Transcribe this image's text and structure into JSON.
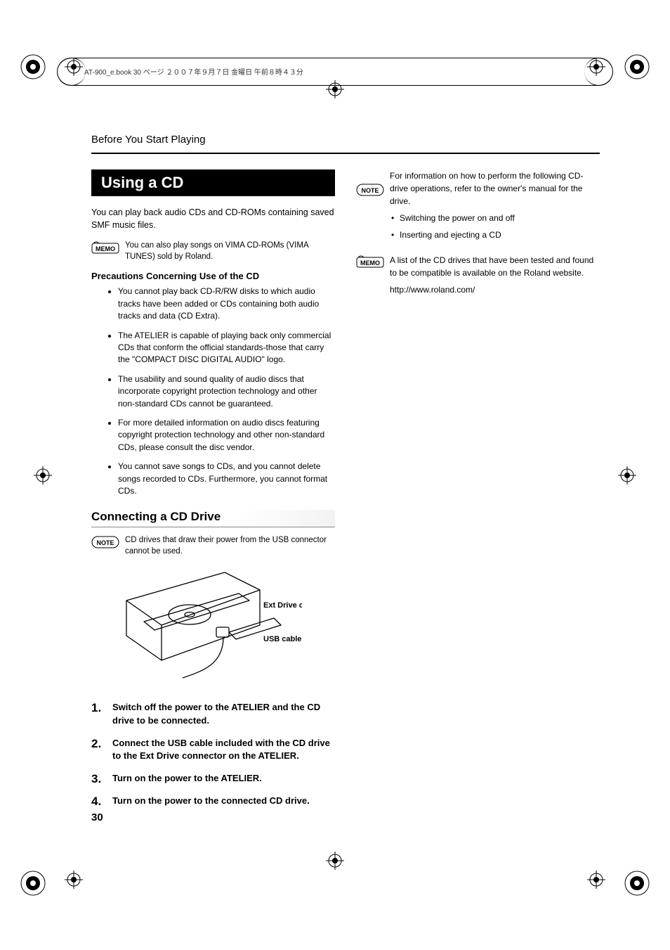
{
  "header": {
    "file_info": "AT-900_e.book  30 ページ  ２００７年９月７日  金曜日  午前８時４３分"
  },
  "running_head": "Before You Start Playing",
  "left": {
    "h1": "Using a CD",
    "intro": "You can play back audio CDs and CD-ROMs containing saved SMF music files.",
    "memo1": "You can also play songs on VIMA CD-ROMs (VIMA TUNES) sold by Roland.",
    "precautions_head": "Precautions Concerning Use of the CD",
    "precautions": [
      "You cannot play back CD-R/RW disks to which audio tracks have been added or CDs containing both audio tracks and data (CD Extra).",
      "The ATELIER is capable of playing back only commercial CDs that conform the official standards-those that carry the \"COMPACT DISC DIGITAL AUDIO\" logo.",
      "The usability and sound quality of audio discs that incorporate copyright protection technology and other non-standard CDs cannot be guaranteed.",
      "For more detailed information on audio discs featuring copyright protection technology and other non-standard CDs, please consult the disc vendor.",
      "You cannot save songs to CDs, and you cannot delete songs recorded to CDs. Furthermore, you cannot format CDs."
    ],
    "h2": "Connecting a CD Drive",
    "note1": "CD drives that draw their power from the USB connector cannot be used.",
    "fig_labels": {
      "ext": "Ext Drive connector",
      "usb": "USB cable"
    },
    "steps": [
      "Switch off the power to the ATELIER and the CD drive to be connected.",
      "Connect the USB cable included with the CD drive to the Ext Drive connector on the ATELIER.",
      "Turn on the power to the ATELIER.",
      "Turn on the power to the connected CD drive."
    ]
  },
  "right": {
    "para1": "For information on how to perform the following CD-drive operations, refer to the owner's manual for the drive.",
    "b1": "Switching the power on and off",
    "b2": "Inserting and ejecting a CD",
    "memo2": "A list of the CD drives that have been tested and found to be compatible is available on the Roland website.",
    "url": "http://www.roland.com/"
  },
  "page_number": "30"
}
